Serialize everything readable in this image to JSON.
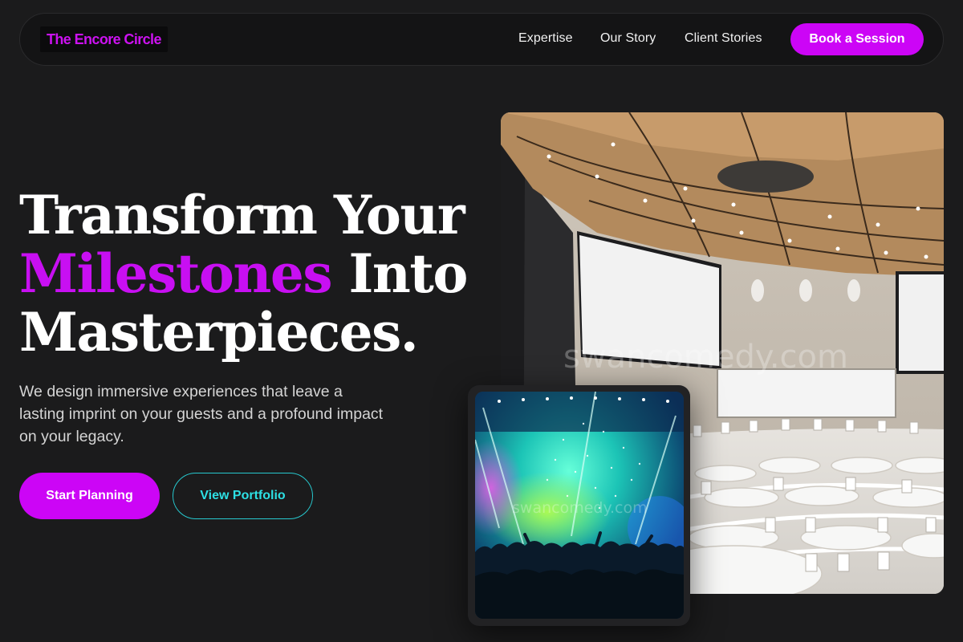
{
  "nav": {
    "logo": "The Encore Circle",
    "links": [
      {
        "label": "Expertise"
      },
      {
        "label": "Our Story"
      },
      {
        "label": "Client Stories"
      }
    ],
    "cta": "Book a Session"
  },
  "hero": {
    "headline_line1": "Transform Your",
    "headline_accent": "Milestones",
    "headline_line2_rest": " Into",
    "headline_line3": "Masterpieces.",
    "subtext": "We design immersive experiences that leave a lasting imprint on your guests and a profound impact on your legacy.",
    "primary_button": "Start Planning",
    "secondary_button": "View Portfolio"
  },
  "images": {
    "hall_watermark": "swancomedy.com",
    "concert_watermark": "swancomedy.com"
  },
  "colors": {
    "background": "#1b1b1c",
    "accent_purple": "#cc05f6",
    "accent_cyan": "#2de0e4"
  }
}
